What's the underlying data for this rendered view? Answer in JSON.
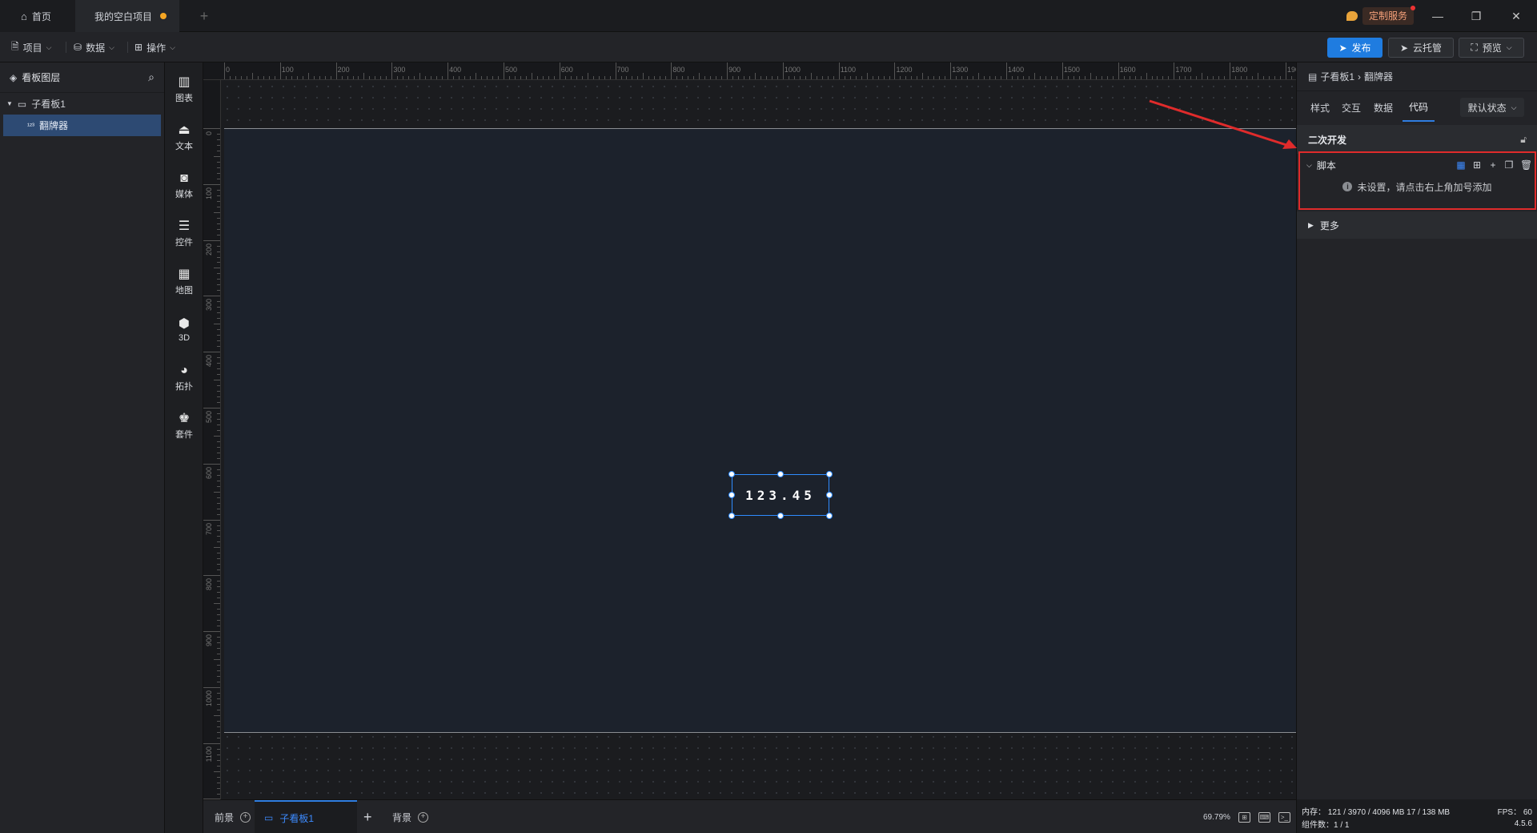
{
  "titlebar": {
    "home_tab": "首页",
    "project_tab": "我的空白项目",
    "add_tab": "+",
    "custom_service": "定制服务",
    "window_controls": {
      "minimize": "—",
      "restore": "❐",
      "close": "✕"
    }
  },
  "toolbar": {
    "menus": [
      {
        "icon": "document-icon",
        "glyph": "🗎",
        "label": "项目"
      },
      {
        "icon": "database-icon",
        "glyph": "⛁",
        "label": "数据"
      },
      {
        "icon": "grid-icon",
        "glyph": "⊞",
        "label": "操作"
      }
    ],
    "publish": "发布",
    "cloud": "云托管",
    "preview": "预览"
  },
  "layers": {
    "title": "看板图层",
    "board": "子看板1",
    "flipper": "翻牌器"
  },
  "components": [
    {
      "icon": "chart-icon",
      "glyph": "▥",
      "label": "图表"
    },
    {
      "icon": "text-icon",
      "glyph": "⏏",
      "label": "文本"
    },
    {
      "icon": "media-icon",
      "glyph": "◙",
      "label": "媒体"
    },
    {
      "icon": "control-icon",
      "glyph": "☰",
      "label": "控件"
    },
    {
      "icon": "map-icon",
      "glyph": "▦",
      "label": "地图"
    },
    {
      "icon": "cube-icon",
      "glyph": "⬢",
      "label": "3D"
    },
    {
      "icon": "topology-icon",
      "glyph": "◕",
      "label": "拓扑"
    },
    {
      "icon": "kit-icon",
      "glyph": "♚",
      "label": "套件"
    }
  ],
  "canvas": {
    "ruler_x_labels": [
      "0",
      "100",
      "200",
      "300",
      "400",
      "500",
      "600",
      "700",
      "800",
      "900",
      "1000",
      "1100",
      "1200",
      "1300",
      "1400",
      "1500",
      "1600",
      "1700",
      "1800",
      "1900"
    ],
    "ruler_y_labels": [
      "0",
      "100",
      "200",
      "300",
      "400",
      "500",
      "600",
      "700",
      "800",
      "900",
      "1000",
      "1100"
    ],
    "flipper_value": "123.45"
  },
  "bottom": {
    "foreground": "前景",
    "board_tab": "子看板1",
    "add": "+",
    "background": "背景",
    "zoom": "69.79%"
  },
  "props": {
    "breadcrumb_parent": "子看板1",
    "breadcrumb_sep": "›",
    "breadcrumb_current": "翻牌器",
    "tabs": [
      "样式",
      "交互",
      "数据",
      "代码"
    ],
    "state_select": "默认状态",
    "section_dev": "二次开发",
    "script_label": "脚本",
    "script_empty": "未设置，请点击右上角加号添加",
    "more_label": "更多"
  },
  "status": {
    "memory": "内存： 121 / 3970 / 4096 MB  17 / 138 MB",
    "fps": "FPS： 60",
    "component_count": "组件数：1 / 1",
    "version": "4.5.6"
  },
  "colors": {
    "accent": "#2f7de0",
    "highlight_box": "#e02b2b",
    "selection": "#2f8cff",
    "screen_bg": "#1c222c"
  }
}
